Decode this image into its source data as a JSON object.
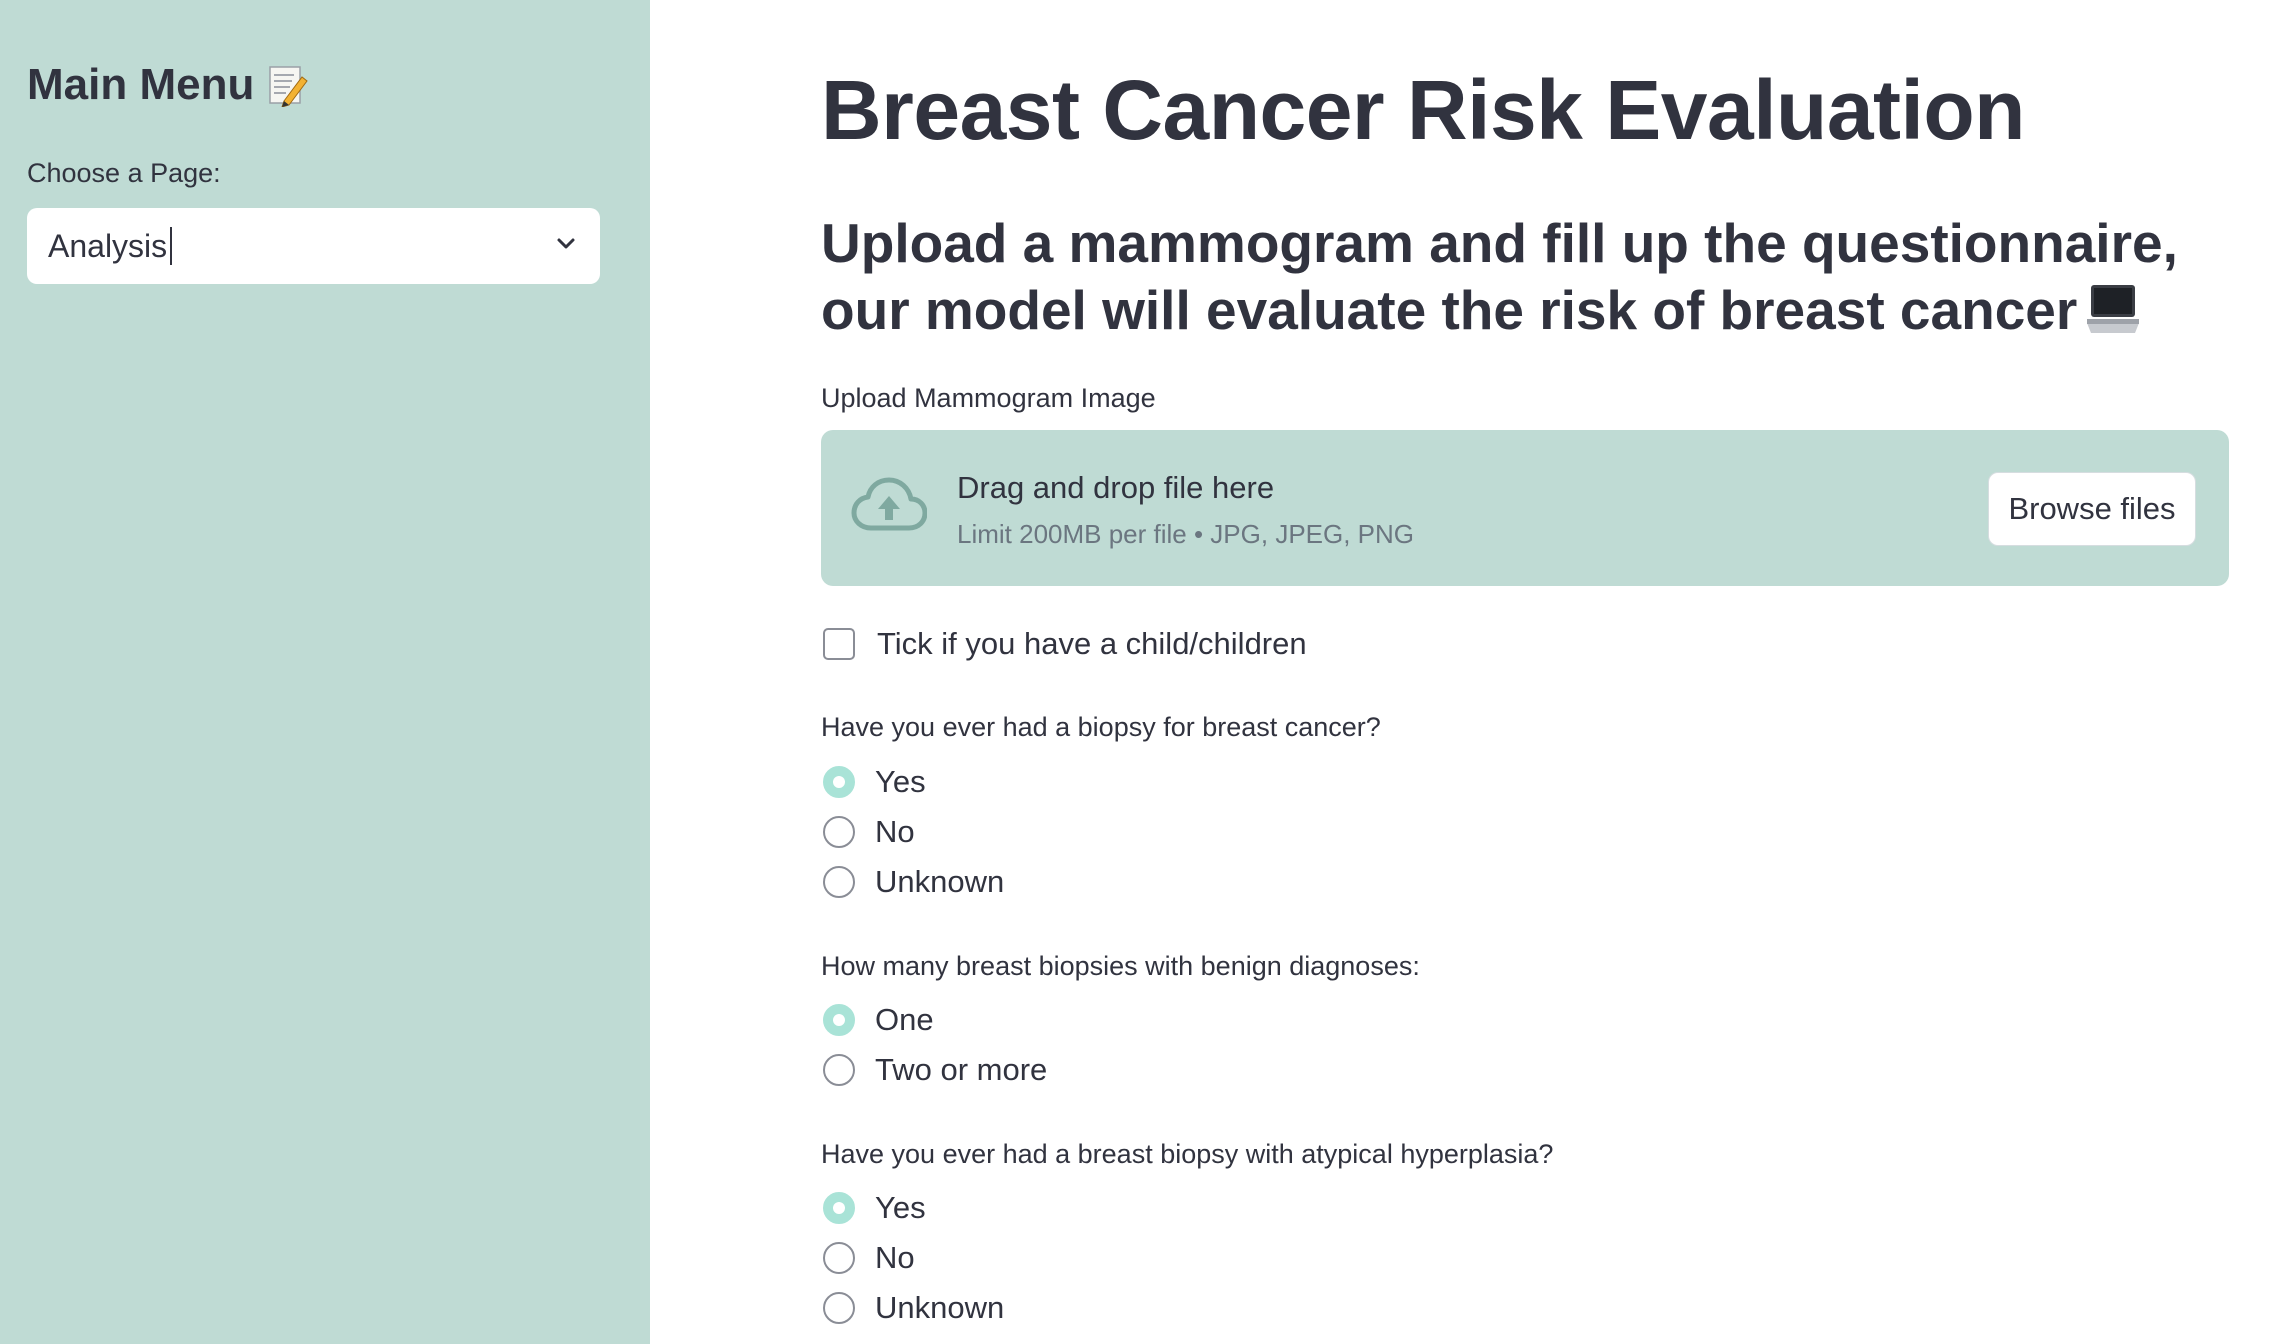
{
  "sidebar": {
    "title": "Main Menu",
    "title_icon": "memo-icon",
    "select_label": "Choose a Page:",
    "select_value": "Analysis"
  },
  "main": {
    "title": "Breast Cancer Risk Evaluation",
    "subtitle": "Upload a mammogram and fill up the questionnaire, our model will evaluate the risk of breast cancer",
    "subtitle_icon": "laptop-icon",
    "upload": {
      "label": "Upload Mammogram Image",
      "drop_text": "Drag and drop file here",
      "limit_text": "Limit 200MB per file • JPG, JPEG, PNG",
      "browse_label": "Browse files"
    },
    "children_checkbox": {
      "label": "Tick if you have a child/children",
      "checked": false
    },
    "questions": [
      {
        "label": "Have you ever had a biopsy for breast cancer?",
        "options": [
          "Yes",
          "No",
          "Unknown"
        ],
        "selected": "Yes"
      },
      {
        "label": "How many breast biopsies with benign diagnoses:",
        "options": [
          "One",
          "Two or more"
        ],
        "selected": "One"
      },
      {
        "label": "Have you ever had a breast biopsy with atypical hyperplasia?",
        "options": [
          "Yes",
          "No",
          "Unknown"
        ],
        "selected": "Yes"
      }
    ]
  },
  "colors": {
    "sidebar_bg": "#bfdbd4",
    "dropzone_bg": "#bfdbd4",
    "radio_selected": "#a9e3d7",
    "text": "#31333f"
  }
}
